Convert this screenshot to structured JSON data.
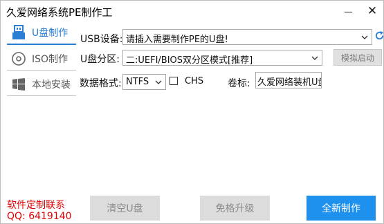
{
  "window": {
    "title": "久爱网络系统PE制作工",
    "minimize_icon": "minimize-icon",
    "close_icon": "close-icon",
    "close_glyph": "✕"
  },
  "sidebar": {
    "items": [
      {
        "label": "U盘制作",
        "icon": "usb-icon",
        "active": true
      },
      {
        "label": "ISO制作",
        "icon": "disc-icon",
        "active": false
      },
      {
        "label": "本地安装",
        "icon": "windows-icon",
        "active": false
      }
    ]
  },
  "form": {
    "usb_label": "USB设备:",
    "usb_value": "请插入需要制作PE的U盘!",
    "partition_label": "U盘分区:",
    "partition_value": "二:UEFI/BIOS双分区模式[推荐]",
    "simulate_button": "模拟启动",
    "format_label": "数据格式:",
    "format_value": "NTFS",
    "chs_label": "CHS",
    "chs_checked": false,
    "volume_label": "卷标:",
    "volume_value": "久爱网络装机U盘"
  },
  "contact": {
    "line1": "软件定制联系",
    "line2": "QQ:  6419140"
  },
  "actions": {
    "clear": "清空U盘",
    "upgrade": "免格升级",
    "new": "全新制作"
  },
  "colors": {
    "accent": "#1e90ee",
    "contact": "#e00000"
  }
}
